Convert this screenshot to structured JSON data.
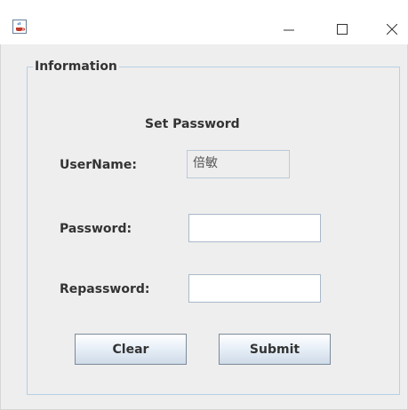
{
  "window": {
    "app_icon": "java-coffee-icon",
    "controls": [
      "minimize-icon",
      "maximize-icon",
      "close-icon"
    ]
  },
  "group": {
    "title": "Information"
  },
  "form": {
    "heading": "Set Password",
    "username_label": "UserName:",
    "username_value": "倍敏",
    "password_label": "Password:",
    "password_value": "",
    "repassword_label": "Repassword:",
    "repassword_value": ""
  },
  "buttons": {
    "clear_label": "Clear",
    "submit_label": "Submit"
  },
  "colors": {
    "background": "#eeeeee",
    "group_border": "#b8cfe5",
    "field_border": "#a9b8c9"
  }
}
